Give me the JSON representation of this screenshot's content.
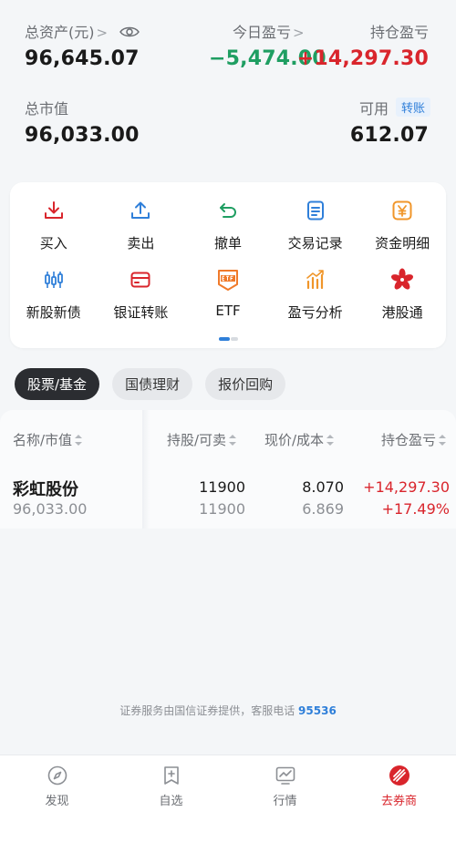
{
  "summary": {
    "total_assets_label": "总资产(元)",
    "total_assets_value": "96,645.07",
    "today_pnl_label": "今日盈亏",
    "today_pnl_value": "−5,474.00",
    "position_pnl_label": "持仓盈亏",
    "position_pnl_value": "+14,297.30",
    "market_value_label": "总市值",
    "market_value_value": "96,033.00",
    "available_label": "可用",
    "transfer_badge": "转账",
    "available_value": "612.07",
    "colors": {
      "loss": "#1f9e62",
      "gain": "#d9252c",
      "accent": "#2f7fd9"
    }
  },
  "quick_actions": {
    "row1": [
      {
        "label": "买入",
        "icon": "download-icon"
      },
      {
        "label": "卖出",
        "icon": "upload-icon"
      },
      {
        "label": "撤单",
        "icon": "undo-icon"
      },
      {
        "label": "交易记录",
        "icon": "document-icon"
      },
      {
        "label": "资金明细",
        "icon": "yuan-icon"
      }
    ],
    "row2": [
      {
        "label": "新股新债",
        "icon": "candlestick-icon"
      },
      {
        "label": "银证转账",
        "icon": "card-icon"
      },
      {
        "label": "ETF",
        "icon": "etf-icon"
      },
      {
        "label": "盈亏分析",
        "icon": "bar-chart-icon"
      },
      {
        "label": "港股通",
        "icon": "bauhinia-icon"
      }
    ]
  },
  "tabs": [
    {
      "label": "股票/基金",
      "active": true
    },
    {
      "label": "国债理财",
      "active": false
    },
    {
      "label": "报价回购",
      "active": false
    }
  ],
  "holdings": {
    "headers": {
      "name": "名称/市值",
      "shares": "持股/可卖",
      "price": "现价/成本",
      "pnl": "持仓盈亏"
    },
    "rows": [
      {
        "name": "彩虹股份",
        "market_value": "96,033.00",
        "shares": "11900",
        "available": "11900",
        "price": "8.070",
        "cost": "6.869",
        "pnl": "+14,297.30",
        "pnl_pct": "+17.49%"
      }
    ]
  },
  "footer": {
    "note": "证券服务由国信证券提供，客服电话",
    "phone": "95536"
  },
  "bottom_nav": [
    {
      "label": "发现",
      "icon": "compass-icon",
      "active": false
    },
    {
      "label": "自选",
      "icon": "bookmark-plus-icon",
      "active": false
    },
    {
      "label": "行情",
      "icon": "chart-monitor-icon",
      "active": false
    },
    {
      "label": "去券商",
      "icon": "broker-icon",
      "active": true
    }
  ]
}
